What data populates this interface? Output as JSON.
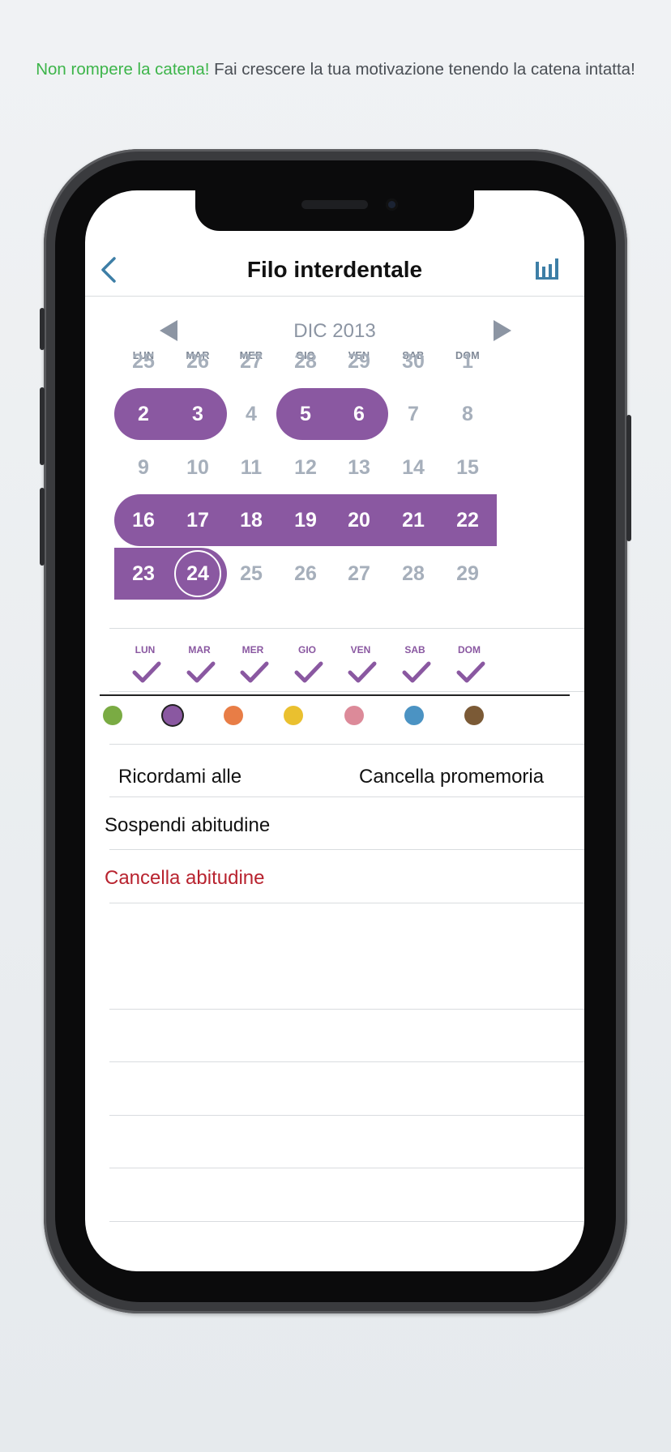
{
  "headline": {
    "highlight": "Non rompere la catena!",
    "text": " Fai crescere la tua motivazione tenendo la catena intatta!"
  },
  "nav": {
    "title": "Filo interdentale",
    "back_icon": "chevron-left-icon",
    "stats_icon": "bar-chart-icon"
  },
  "calendar": {
    "month": "DIC 2013",
    "weekdays": [
      "LUN",
      "MAR",
      "MER",
      "GIO",
      "VEN",
      "SAB",
      "DOM"
    ],
    "weeks": [
      [
        "25",
        "26",
        "27",
        "28",
        "29",
        "30",
        "1"
      ],
      [
        "2",
        "3",
        "4",
        "5",
        "6",
        "7",
        "8"
      ],
      [
        "9",
        "10",
        "11",
        "12",
        "13",
        "14",
        "15"
      ],
      [
        "16",
        "17",
        "18",
        "19",
        "20",
        "21",
        "22"
      ],
      [
        "23",
        "24",
        "25",
        "26",
        "27",
        "28",
        "29"
      ]
    ],
    "completed_days": [
      "2",
      "3",
      "5",
      "6",
      "16",
      "17",
      "18",
      "19",
      "20",
      "21",
      "22",
      "23",
      "24"
    ],
    "today": "24"
  },
  "schedule": {
    "days": [
      "LUN",
      "MAR",
      "MER",
      "GIO",
      "VEN",
      "SAB",
      "DOM"
    ],
    "check_icon": "checkmark-icon"
  },
  "colors": {
    "accent": "#8a58a1",
    "options": [
      "#7aab43",
      "#8a58a1",
      "#e87d46",
      "#eac02f",
      "#dc8a99",
      "#4b93c3",
      "#7b5a36"
    ],
    "selected": "#8a58a1"
  },
  "settings": {
    "remind_label": "Ricordami alle",
    "cancel_reminder_label": "Cancella promemoria",
    "pause_label": "Sospendi abitudine",
    "delete_label": "Cancella abitudine"
  }
}
